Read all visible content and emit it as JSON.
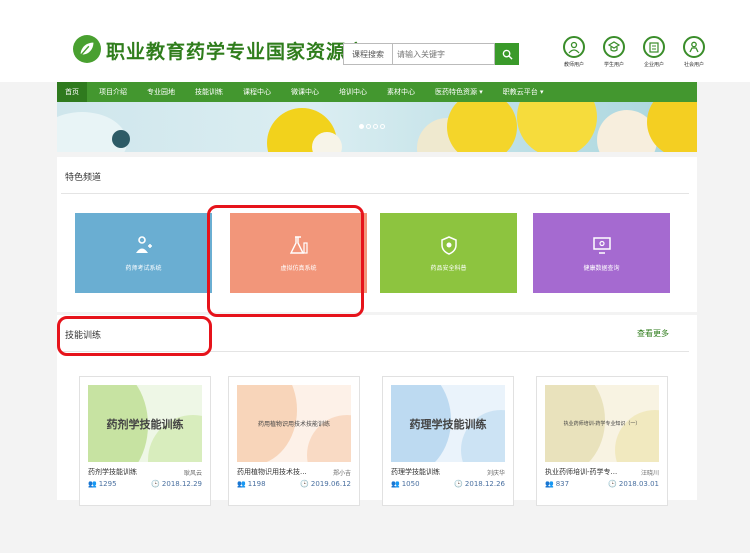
{
  "site": {
    "title": "职业教育药学专业国家资源库"
  },
  "search": {
    "type_label": "课程搜索",
    "placeholder": "请输入关键字"
  },
  "users": [
    {
      "label": "教师用户",
      "icon": "teacher-icon"
    },
    {
      "label": "学生用户",
      "icon": "student-icon"
    },
    {
      "label": "企业用户",
      "icon": "enterprise-icon"
    },
    {
      "label": "社会用户",
      "icon": "public-user-icon"
    }
  ],
  "nav": [
    {
      "label": "首页"
    },
    {
      "label": "项目介绍"
    },
    {
      "label": "专业园地"
    },
    {
      "label": "技能训练"
    },
    {
      "label": "课程中心"
    },
    {
      "label": "微课中心"
    },
    {
      "label": "培训中心"
    },
    {
      "label": "素材中心"
    },
    {
      "label": "医药特色资源"
    },
    {
      "label": "职教云平台"
    }
  ],
  "featured": {
    "title": "特色频道",
    "tiles": [
      {
        "label": "药师考试系统",
        "color": "#6aaed2",
        "icon": "pharmacist-icon"
      },
      {
        "label": "虚拟仿真系统",
        "color": "#f2967a",
        "icon": "flask-icon"
      },
      {
        "label": "药品安全科普",
        "color": "#8dc43f",
        "icon": "shield-icon"
      },
      {
        "label": "健康数据查询",
        "color": "#a56ad0",
        "icon": "monitor-icon"
      }
    ]
  },
  "skills": {
    "title": "技能训练",
    "more_label": "查看更多",
    "courses": [
      {
        "thumb_text": "药剂学技能训练",
        "name": "药剂学技能训练",
        "author": "耿风云",
        "views": "1295",
        "date": "2018.12.29"
      },
      {
        "thumb_text": "药用植物识用技术技能训练",
        "name": "药用植物识用技术技...",
        "author": "郑小吉",
        "views": "1198",
        "date": "2019.06.12"
      },
      {
        "thumb_text": "药理学技能训练",
        "name": "药理学技能训练",
        "author": "刘庆华",
        "views": "1050",
        "date": "2018.12.26"
      },
      {
        "thumb_text": "执业药师培训-药学专业知识（一）",
        "name": "执业药师培训-药学专...",
        "author": "汪晓川",
        "views": "837",
        "date": "2018.03.01"
      }
    ]
  },
  "colors": {
    "brand_green": "#43972f",
    "highlight_red": "#e6131b"
  }
}
